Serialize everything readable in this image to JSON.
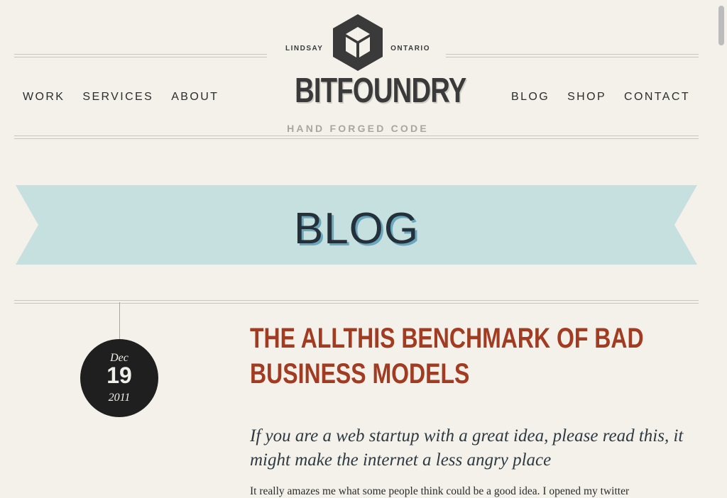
{
  "nav": {
    "left": [
      "WORK",
      "SERVICES",
      "ABOUT"
    ],
    "right": [
      "BLOG",
      "SHOP",
      "CONTACT"
    ]
  },
  "logo": {
    "location_left": "LINDSAY",
    "location_right": "ONTARIO",
    "brand": "BITFOUNDRY",
    "tagline": "HAND FORGED CODE"
  },
  "banner": {
    "title": "BLOG"
  },
  "post": {
    "date": {
      "month": "Dec",
      "day": "19",
      "year": "2011"
    },
    "title": "THE ALLTHIS BENCHMARK OF BAD BUSINESS MODELS",
    "lede": "If you are a web startup with a great idea, please read this, it might make the internet a less angry place",
    "body_start": "It really amazes me what some people think could be a good idea. I opened my twitter"
  },
  "colors": {
    "background": "#f3f1ea",
    "ribbon": "#c6dfdf",
    "ribbon_text": "#24303a",
    "title_red": "#a13b22",
    "badge": "#1f1f1f"
  }
}
